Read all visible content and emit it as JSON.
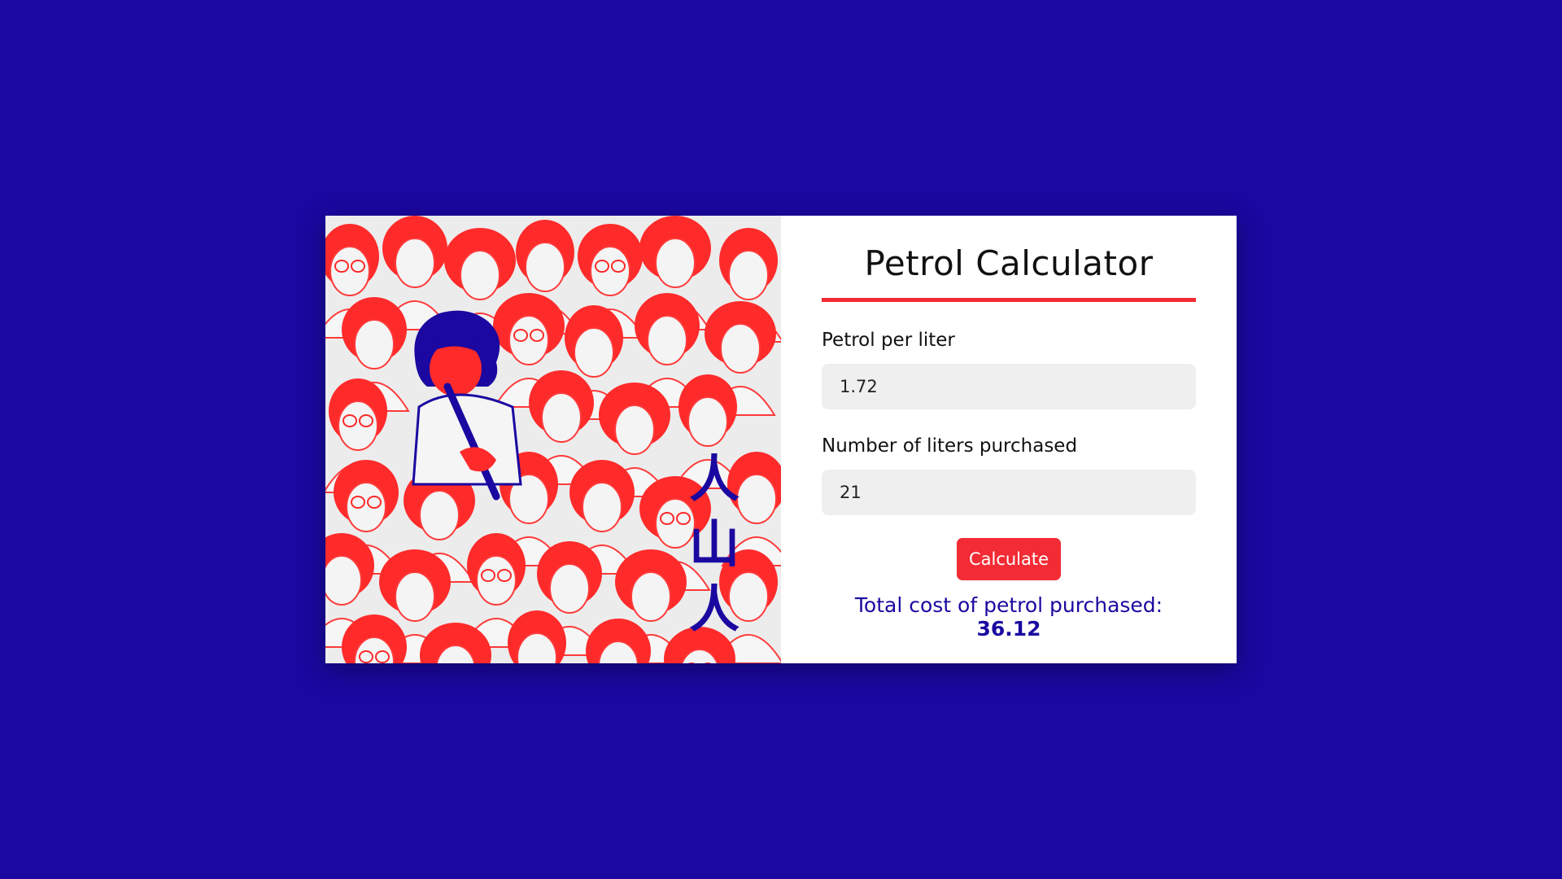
{
  "form": {
    "title": "Petrol Calculator",
    "price_label": "Petrol per liter",
    "price_value": "1.72",
    "liters_label": "Number of liters purchased",
    "liters_value": "21",
    "button_label": "Calculate",
    "result_label": "Total cost of petrol purchased:",
    "result_value": "36.12"
  },
  "illustration": {
    "vertical_text": [
      "人",
      "山",
      "人"
    ]
  },
  "colors": {
    "background": "#1a08a0",
    "accent": "#f22b34",
    "result_text": "#1a08a0",
    "input_bg": "#efefef"
  }
}
